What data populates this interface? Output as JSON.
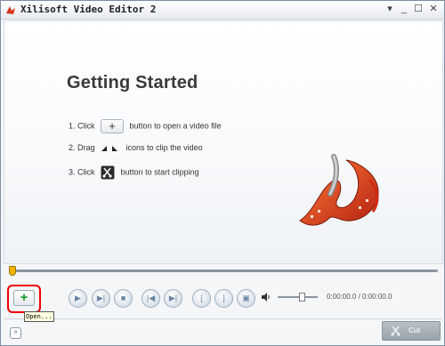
{
  "window": {
    "title": "Xilisoft Video Editor 2",
    "controls": {
      "minimize": "_",
      "maximize": "☐",
      "close": "✕",
      "menu": "▾"
    }
  },
  "getting_started": {
    "heading": "Getting Started",
    "step1_prefix": "1. Click",
    "step1_button": "+",
    "step1_suffix": "button to open a video file",
    "step2_prefix": "2. Drag",
    "step2_suffix": "icons to clip the video",
    "step3_prefix": "3. Click",
    "step3_suffix": "button to start clipping"
  },
  "toolbar": {
    "add_label": "+",
    "tooltip": "Open...",
    "time_display": "0:00:00.0 / 0:00:00.0",
    "volume_level": 0.6,
    "cut_label": "Cut"
  },
  "timeline": {
    "position": 0
  },
  "colors": {
    "accent_green": "#1b9a2a",
    "highlight": "#ee0000",
    "playhead": "#f0b400"
  }
}
